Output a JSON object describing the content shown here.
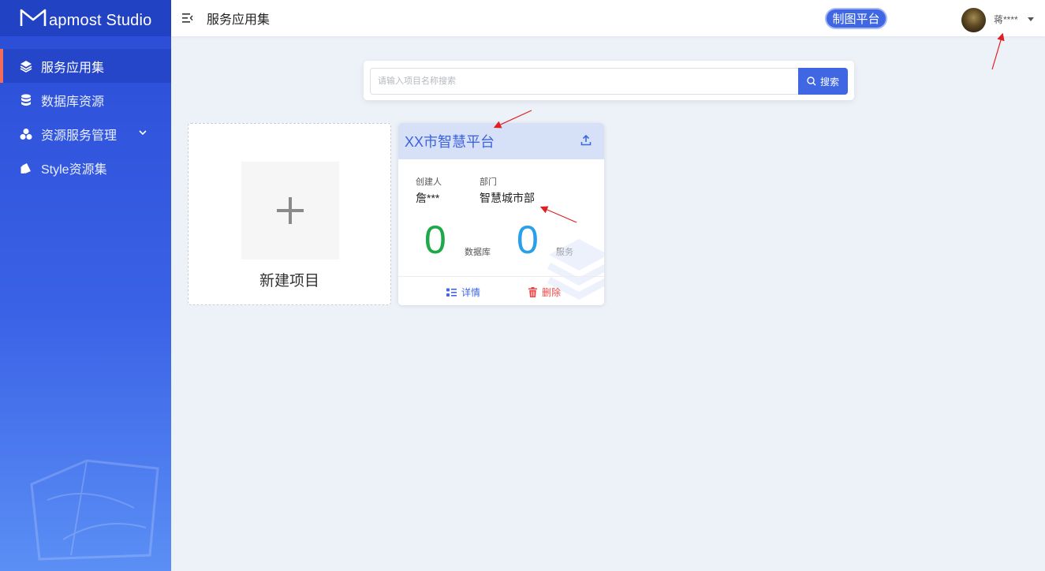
{
  "app": {
    "logo_text": "apmost Studio"
  },
  "sidebar": {
    "items": [
      {
        "label": "服务应用集",
        "icon": "layers-icon"
      },
      {
        "label": "数据库资源",
        "icon": "database-icon"
      },
      {
        "label": "资源服务管理",
        "icon": "cluster-icon"
      },
      {
        "label": "Style资源集",
        "icon": "style-icon"
      }
    ]
  },
  "header": {
    "title": "服务应用集",
    "platform_button": "制图平台",
    "user_name": "蒋****"
  },
  "search": {
    "placeholder": "请输入项目名称搜索",
    "value": "",
    "button_label": "搜索"
  },
  "new_project": {
    "label": "新建项目"
  },
  "project": {
    "title": "XX市智慧平台",
    "creator_label": "创建人",
    "creator_value": "詹***",
    "department_label": "部门",
    "department_value": "智慧城市部",
    "database_count": "0",
    "database_label": "数据库",
    "service_count": "0",
    "service_label": "服务",
    "detail_label": "详情",
    "delete_label": "删除"
  },
  "colors": {
    "primary": "#3f66e3",
    "sidebar": "#2b4cd6",
    "accent_bar": "#f26d5b",
    "green": "#1fa84a",
    "blue": "#2aa0ea",
    "danger": "#f04848"
  }
}
